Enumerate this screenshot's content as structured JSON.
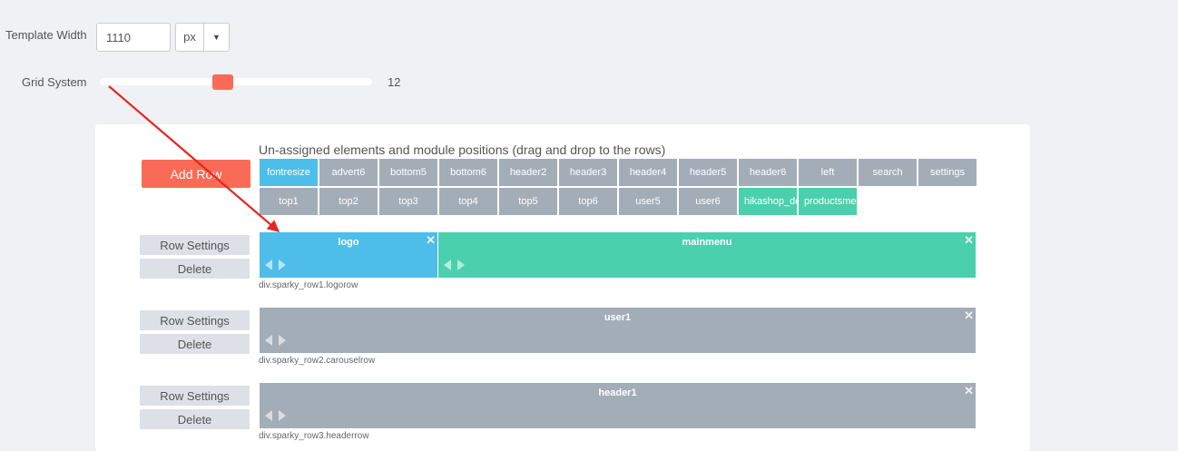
{
  "template_width": {
    "label": "Template Width",
    "value": "1110",
    "unit": "px"
  },
  "grid_system": {
    "label": "Grid System",
    "value": "12",
    "slider_fraction": 0.45
  },
  "unassigned": {
    "title": "Un-assigned elements and module positions (drag and drop to the rows)",
    "add_row_label": "Add Row",
    "chips": [
      {
        "label": "fontresize",
        "variant": "blue"
      },
      {
        "label": "advert6",
        "variant": "gray"
      },
      {
        "label": "bottom5",
        "variant": "gray"
      },
      {
        "label": "bottom6",
        "variant": "gray"
      },
      {
        "label": "header2",
        "variant": "gray"
      },
      {
        "label": "header3",
        "variant": "gray"
      },
      {
        "label": "header4",
        "variant": "gray"
      },
      {
        "label": "header5",
        "variant": "gray"
      },
      {
        "label": "header6",
        "variant": "gray"
      },
      {
        "label": "left",
        "variant": "gray"
      },
      {
        "label": "search",
        "variant": "gray"
      },
      {
        "label": "settings",
        "variant": "gray"
      },
      {
        "label": "top1",
        "variant": "gray"
      },
      {
        "label": "top2",
        "variant": "gray"
      },
      {
        "label": "top3",
        "variant": "gray"
      },
      {
        "label": "top4",
        "variant": "gray"
      },
      {
        "label": "top5",
        "variant": "gray"
      },
      {
        "label": "top6",
        "variant": "gray"
      },
      {
        "label": "user5",
        "variant": "gray"
      },
      {
        "label": "user6",
        "variant": "gray"
      },
      {
        "label": "hikashop_de",
        "variant": "green"
      },
      {
        "label": "productsme",
        "variant": "green"
      }
    ]
  },
  "row_controls": {
    "settings_label": "Row Settings",
    "delete_label": "Delete",
    "close_glyph": "✕"
  },
  "rows": [
    {
      "class_label": "div.sparky_row1.logorow",
      "modules": [
        {
          "title": "logo",
          "variant": "blue"
        },
        {
          "title": "mainmenu",
          "variant": "green"
        }
      ]
    },
    {
      "class_label": "div.sparky_row2.carouselrow",
      "modules": [
        {
          "title": "user1",
          "variant": "gray"
        }
      ]
    },
    {
      "class_label": "div.sparky_row3.headerrow",
      "modules": [
        {
          "title": "header1",
          "variant": "gray"
        }
      ]
    }
  ],
  "colors": {
    "accent": "#f96b56",
    "blue": "#4dbde9",
    "green": "#4ad0ad",
    "gray": "#a3adb8",
    "background": "#f0f1f5",
    "annotation_arrow": "#e8251f"
  }
}
